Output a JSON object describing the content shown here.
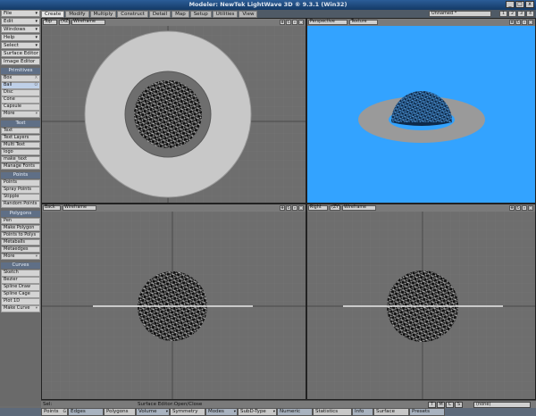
{
  "window": {
    "title": "Modeler: NewTek LightWave 3D ® 9.3.1 (Win32)",
    "controls": [
      "_",
      "□",
      "x"
    ]
  },
  "left_menu": {
    "top_buttons": [
      {
        "label": "File",
        "arrow": "▾"
      },
      {
        "label": "Edit",
        "arrow": "▾"
      },
      {
        "label": "Windows",
        "arrow": "▾"
      },
      {
        "label": "Help",
        "arrow": "▾"
      },
      {
        "label": "Select",
        "arrow": "▾"
      },
      {
        "label": "Surface Editor"
      },
      {
        "label": "Image Editor"
      }
    ],
    "groups": [
      {
        "title": "Primitives",
        "items": [
          {
            "label": "Box",
            "key": "X"
          },
          {
            "label": "Ball",
            "key": "O",
            "selected": true
          },
          {
            "label": "Disc"
          },
          {
            "label": "Cone"
          },
          {
            "label": "Capsule"
          },
          {
            "label": "More",
            "arrow": "▾"
          }
        ]
      },
      {
        "title": "Text",
        "items": [
          {
            "label": "Text"
          },
          {
            "label": "Text Layers"
          },
          {
            "label": "Multi Text"
          },
          {
            "label": "logo"
          },
          {
            "label": "make_text"
          },
          {
            "label": "Manage Fonts"
          }
        ]
      },
      {
        "title": "Points",
        "items": [
          {
            "label": "Points"
          },
          {
            "label": "Spray Points"
          },
          {
            "label": "Stipple"
          },
          {
            "label": "Random Points"
          }
        ]
      },
      {
        "title": "Polygons",
        "items": [
          {
            "label": "Pen"
          },
          {
            "label": "Make Polygon"
          },
          {
            "label": "Points to Polys"
          },
          {
            "label": "Metaballs"
          },
          {
            "label": "Metaedges"
          },
          {
            "label": "More",
            "arrow": "▾"
          }
        ]
      },
      {
        "title": "Curves",
        "items": [
          {
            "label": "Sketch"
          },
          {
            "label": "Bezier"
          },
          {
            "label": "Spline Draw"
          },
          {
            "label": "Spline Cage"
          },
          {
            "label": "Plot 1D"
          },
          {
            "label": "Make Curve",
            "arrow": "▾"
          }
        ]
      }
    ]
  },
  "tabs": [
    "Create",
    "Modify",
    "Multiply",
    "Construct",
    "Detail",
    "Map",
    "Setup",
    "Utilities",
    "View"
  ],
  "active_tab": "Create",
  "layers": {
    "object": "Unnamed *",
    "buttons": [
      "1",
      "2",
      "3",
      "4"
    ]
  },
  "viewports": [
    {
      "view": "Top",
      "axis": "(XZ)",
      "mode": "Wireframe"
    },
    {
      "view": "Perspective",
      "mode": "Texture"
    },
    {
      "view": "Back",
      "mode": "Wireframe"
    },
    {
      "view": "Right",
      "axis": "(ZY)",
      "mode": "Wireframe"
    }
  ],
  "status": {
    "selection": "Sel:",
    "message": "Surface Editor:Open/Close",
    "toggles": [
      "T",
      "M",
      "C",
      "S"
    ],
    "surface": "(none)"
  },
  "bottom_bar": {
    "sel_mode": "1 m",
    "items": [
      {
        "label": "Points",
        "key": "G"
      },
      {
        "label": "Edges"
      },
      {
        "label": "Polygons"
      },
      {
        "label": "Volume",
        "arrow": "▾"
      },
      {
        "label": "Symmetry"
      },
      {
        "label": "Modes",
        "arrow": "▾"
      },
      {
        "label": "SubD-Type",
        "arrow": "▾"
      },
      {
        "label": "Numeric"
      },
      {
        "label": "Statistics"
      },
      {
        "label": "Info"
      },
      {
        "label": "Surface"
      },
      {
        "label": "Presets"
      }
    ]
  },
  "colors": {
    "viewport_bg": "#6e6e6e",
    "perspective_bg": "#33a3ff",
    "title_gradient": [
      "#2b5d98",
      "#143a66"
    ],
    "ring": "#c8c8c8"
  }
}
